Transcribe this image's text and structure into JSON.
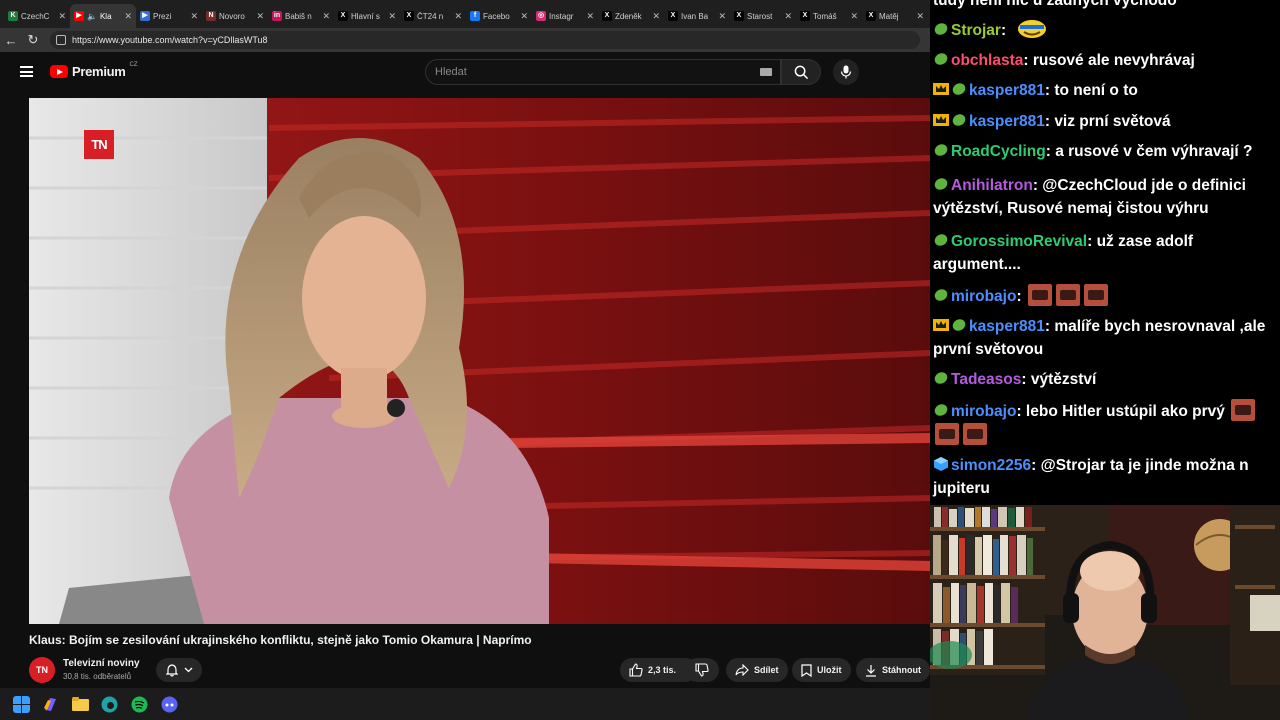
{
  "browser": {
    "tabs": [
      {
        "label": "CzechC",
        "fav_color": "#1f7d3a",
        "fav_glyph": "K"
      },
      {
        "label": "Kla",
        "fav_color": "#ff0000",
        "fav_glyph": "▶",
        "muted": true
      },
      {
        "label": "Prezi",
        "fav_color": "#2f6fd6",
        "fav_glyph": "▶"
      },
      {
        "label": "Novoro",
        "fav_color": "#7b2a2a",
        "fav_glyph": "N"
      },
      {
        "label": "Babiš n",
        "fav_color": "#c2185b",
        "fav_glyph": "in"
      },
      {
        "label": "Hlavní s",
        "fav_color": "#000000",
        "fav_glyph": "X"
      },
      {
        "label": "ČT24 n",
        "fav_color": "#000000",
        "fav_glyph": "X"
      },
      {
        "label": "Facebo",
        "fav_color": "#1877f2",
        "fav_glyph": "f"
      },
      {
        "label": "Instagr",
        "fav_color": "#d62976",
        "fav_glyph": "◎"
      },
      {
        "label": "Zdeněk",
        "fav_color": "#000000",
        "fav_glyph": "X"
      },
      {
        "label": "Ivan Ba",
        "fav_color": "#000000",
        "fav_glyph": "X"
      },
      {
        "label": "Starost",
        "fav_color": "#000000",
        "fav_glyph": "X"
      },
      {
        "label": "Tomáš",
        "fav_color": "#000000",
        "fav_glyph": "X"
      },
      {
        "label": "Matěj",
        "fav_color": "#000000",
        "fav_glyph": "X"
      }
    ],
    "url": "https://www.youtube.com/watch?v=yCDllasWTu8"
  },
  "youtube": {
    "logo_text": "Premium",
    "logo_region": "CZ",
    "search_placeholder": "Hledat",
    "video_title": "Klaus: Bojím se zesilování ukrajinského konfliktu, stejně jako Tomio Okamura | Naprímo",
    "channel_name": "Televizní noviny",
    "channel_avatar": "TN",
    "subscribers": "30,8 tis. odběratelů",
    "likes": "2,3 tis.",
    "share": "Sdílet",
    "save": "Uložit",
    "download": "Stáhnout",
    "tn_logo": "TN"
  },
  "chat": {
    "top_partial": "tudy není nic u žádných vychodo",
    "messages": [
      {
        "user": "Strojar",
        "color": "#9acd32",
        "text": "",
        "emote_only": true
      },
      {
        "user": "obchlasta",
        "color": "#ff4d6d",
        "text": "rusové ale nevyhrávaj"
      },
      {
        "user": "kasper881",
        "color": "#4b8fff",
        "text": "to není o to",
        "crown": true
      },
      {
        "user": "kasper881",
        "color": "#4b8fff",
        "text": "viz prní světová",
        "crown": true
      },
      {
        "user": "RoadCycling",
        "color": "#2ecc71",
        "text": "a rusové v čem výhravají ?"
      },
      {
        "user": "Anihilatron",
        "color": "#b65be0",
        "text": "@CzechCloud jde o definici výtězství, Rusové nemaj čistou výhru"
      },
      {
        "user": "GorossimoRevival",
        "color": "#2ecc71",
        "text": "už zase adolf argument...."
      },
      {
        "user": "mirobajo",
        "color": "#4b8fff",
        "text": "",
        "emotes": 3
      },
      {
        "user": "kasper881",
        "color": "#4b8fff",
        "text": "malíře bych nesrovnaval ,ale první světovou",
        "crown": true
      },
      {
        "user": "Tadeasos",
        "color": "#b65be0",
        "text": "výtězství"
      },
      {
        "user": "mirobajo",
        "color": "#4b8fff",
        "text": "lebo Hitler ustúpil ako prvý",
        "emotes": 3
      },
      {
        "user": "simon2256",
        "color": "#4b8fff",
        "text": "@Strojar ta je jinde možna n jupiteru",
        "badge": "cube"
      }
    ]
  }
}
